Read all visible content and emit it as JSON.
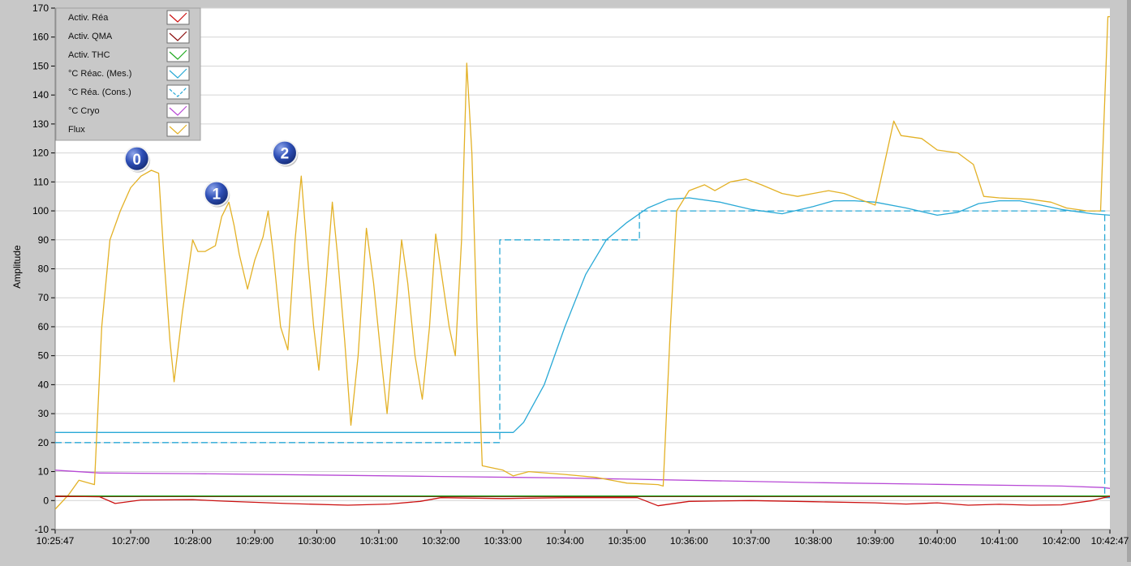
{
  "chart_data": {
    "type": "line",
    "ylabel": "Amplitude",
    "xlabel": "",
    "ylim": [
      -10,
      170
    ],
    "yticks": [
      -10,
      0,
      10,
      20,
      30,
      40,
      50,
      60,
      70,
      80,
      90,
      100,
      110,
      120,
      130,
      140,
      150,
      160,
      170
    ],
    "xlim": [
      "10:25:47",
      "10:42:47"
    ],
    "xticks": [
      "10:25:47",
      "10:27:00",
      "10:28:00",
      "10:29:00",
      "10:30:00",
      "10:31:00",
      "10:32:00",
      "10:33:00",
      "10:34:00",
      "10:35:00",
      "10:36:00",
      "10:37:00",
      "10:38:00",
      "10:39:00",
      "10:40:00",
      "10:41:00",
      "10:42:00",
      "10:42:47"
    ],
    "grid": "horizontal",
    "legend_position": "top-left",
    "annotations": [
      {
        "label": "0",
        "x": "10:27:06",
        "y": 118
      },
      {
        "label": "1",
        "x": "10:28:23",
        "y": 106
      },
      {
        "label": "2",
        "x": "10:29:29",
        "y": 120
      }
    ],
    "series": [
      {
        "name": "Activ. Réa",
        "color": "#cc1111",
        "style": "solid",
        "points": [
          [
            "10:25:47",
            1.5
          ],
          [
            "10:26:30",
            1.3
          ],
          [
            "10:26:45",
            -1
          ],
          [
            "10:27:10",
            0.2
          ],
          [
            "10:28:00",
            0.3
          ],
          [
            "10:28:30",
            -0.2
          ],
          [
            "10:29:30",
            -1
          ],
          [
            "10:30:30",
            -1.6
          ],
          [
            "10:31:10",
            -1.2
          ],
          [
            "10:31:40",
            -0.3
          ],
          [
            "10:32:00",
            1
          ],
          [
            "10:33:00",
            0.7
          ],
          [
            "10:34:00",
            1
          ],
          [
            "10:35:10",
            1
          ],
          [
            "10:35:30",
            -1.8
          ],
          [
            "10:36:00",
            -0.3
          ],
          [
            "10:37:00",
            0
          ],
          [
            "10:38:00",
            -0.4
          ],
          [
            "10:39:00",
            -0.8
          ],
          [
            "10:39:30",
            -1.2
          ],
          [
            "10:40:00",
            -0.8
          ],
          [
            "10:40:30",
            -1.6
          ],
          [
            "10:41:00",
            -1.3
          ],
          [
            "10:41:30",
            -1.6
          ],
          [
            "10:42:00",
            -1.5
          ],
          [
            "10:42:30",
            0
          ],
          [
            "10:42:47",
            1.5
          ]
        ]
      },
      {
        "name": "Activ. QMA",
        "color": "#8b0d0d",
        "style": "solid",
        "points": [
          [
            "10:25:47",
            1.4
          ],
          [
            "10:42:47",
            1.4
          ]
        ]
      },
      {
        "name": "Activ. THC",
        "color": "#22aa22",
        "style": "solid",
        "points": [
          [
            "10:25:47",
            1.6
          ],
          [
            "10:42:47",
            1.6
          ]
        ]
      },
      {
        "name": "°C Réac. (Mes.)",
        "color": "#29a9d6",
        "style": "solid",
        "points": [
          [
            "10:25:47",
            23.5
          ],
          [
            "10:33:00",
            23.5
          ],
          [
            "10:33:10",
            23.5
          ],
          [
            "10:33:20",
            27
          ],
          [
            "10:33:40",
            40
          ],
          [
            "10:34:00",
            60
          ],
          [
            "10:34:20",
            78
          ],
          [
            "10:34:40",
            90
          ],
          [
            "10:35:00",
            96
          ],
          [
            "10:35:20",
            101
          ],
          [
            "10:35:40",
            104
          ],
          [
            "10:36:00",
            104.5
          ],
          [
            "10:36:30",
            103
          ],
          [
            "10:37:00",
            100.5
          ],
          [
            "10:37:30",
            99
          ],
          [
            "10:38:00",
            101.5
          ],
          [
            "10:38:20",
            103.5
          ],
          [
            "10:38:40",
            103.5
          ],
          [
            "10:39:00",
            103
          ],
          [
            "10:39:30",
            101
          ],
          [
            "10:40:00",
            98.5
          ],
          [
            "10:40:20",
            99.5
          ],
          [
            "10:40:40",
            102.5
          ],
          [
            "10:41:00",
            103.5
          ],
          [
            "10:41:20",
            103.5
          ],
          [
            "10:41:40",
            102
          ],
          [
            "10:42:00",
            100.5
          ],
          [
            "10:42:30",
            99
          ],
          [
            "10:42:47",
            98.5
          ]
        ]
      },
      {
        "name": "°C Réa. (Cons.)",
        "color": "#29a9d6",
        "style": "dashed",
        "points": [
          [
            "10:25:47",
            20
          ],
          [
            "10:32:57",
            20
          ],
          [
            "10:32:57",
            90
          ],
          [
            "10:35:12",
            90
          ],
          [
            "10:35:12",
            100
          ],
          [
            "10:42:42",
            100
          ],
          [
            "10:42:42",
            1
          ],
          [
            "10:42:47",
            1
          ]
        ]
      },
      {
        "name": "°C Cryo",
        "color": "#b84ad6",
        "style": "solid",
        "points": [
          [
            "10:25:47",
            10.5
          ],
          [
            "10:26:30",
            9.5
          ],
          [
            "10:28:00",
            9.3
          ],
          [
            "10:30:00",
            8.8
          ],
          [
            "10:32:00",
            8.3
          ],
          [
            "10:34:00",
            7.8
          ],
          [
            "10:36:00",
            7
          ],
          [
            "10:38:00",
            6.2
          ],
          [
            "10:40:00",
            5.6
          ],
          [
            "10:42:00",
            5
          ],
          [
            "10:42:40",
            4.5
          ],
          [
            "10:42:47",
            4.2
          ]
        ]
      },
      {
        "name": "Flux",
        "color": "#e3b126",
        "style": "solid",
        "points": [
          [
            "10:25:47",
            -3
          ],
          [
            "10:26:00",
            2
          ],
          [
            "10:26:10",
            7
          ],
          [
            "10:26:25",
            5.5
          ],
          [
            "10:26:32",
            60
          ],
          [
            "10:26:40",
            90
          ],
          [
            "10:26:50",
            100
          ],
          [
            "10:27:00",
            108
          ],
          [
            "10:27:10",
            112
          ],
          [
            "10:27:20",
            114
          ],
          [
            "10:27:27",
            113
          ],
          [
            "10:27:32",
            85
          ],
          [
            "10:27:38",
            55
          ],
          [
            "10:27:42",
            41
          ],
          [
            "10:27:50",
            65
          ],
          [
            "10:27:56",
            80
          ],
          [
            "10:28:00",
            90
          ],
          [
            "10:28:05",
            86
          ],
          [
            "10:28:12",
            86
          ],
          [
            "10:28:22",
            88
          ],
          [
            "10:28:28",
            98
          ],
          [
            "10:28:35",
            103
          ],
          [
            "10:28:40",
            95
          ],
          [
            "10:28:45",
            85
          ],
          [
            "10:28:53",
            73
          ],
          [
            "10:29:00",
            83
          ],
          [
            "10:29:08",
            91
          ],
          [
            "10:29:13",
            100
          ],
          [
            "10:29:18",
            85
          ],
          [
            "10:29:25",
            60
          ],
          [
            "10:29:32",
            52
          ],
          [
            "10:29:39",
            90
          ],
          [
            "10:29:45",
            112
          ],
          [
            "10:29:52",
            80
          ],
          [
            "10:29:57",
            60
          ],
          [
            "10:30:02",
            45
          ],
          [
            "10:30:09",
            75
          ],
          [
            "10:30:15",
            103
          ],
          [
            "10:30:20",
            85
          ],
          [
            "10:30:27",
            55
          ],
          [
            "10:30:33",
            26
          ],
          [
            "10:30:40",
            50
          ],
          [
            "10:30:48",
            94
          ],
          [
            "10:30:55",
            75
          ],
          [
            "10:31:02",
            50
          ],
          [
            "10:31:08",
            30
          ],
          [
            "10:31:14",
            55
          ],
          [
            "10:31:22",
            90
          ],
          [
            "10:31:28",
            75
          ],
          [
            "10:31:35",
            50
          ],
          [
            "10:31:42",
            35
          ],
          [
            "10:31:49",
            60
          ],
          [
            "10:31:55",
            92
          ],
          [
            "10:32:02",
            75
          ],
          [
            "10:32:08",
            60
          ],
          [
            "10:32:14",
            50
          ],
          [
            "10:32:20",
            90
          ],
          [
            "10:32:25",
            151
          ],
          [
            "10:32:30",
            120
          ],
          [
            "10:32:35",
            60
          ],
          [
            "10:32:40",
            12
          ],
          [
            "10:33:00",
            10.5
          ],
          [
            "10:33:10",
            8.5
          ],
          [
            "10:33:25",
            10
          ],
          [
            "10:34:00",
            9
          ],
          [
            "10:34:30",
            8
          ],
          [
            "10:35:00",
            6
          ],
          [
            "10:35:30",
            5.5
          ],
          [
            "10:35:35",
            5
          ],
          [
            "10:35:42",
            60
          ],
          [
            "10:35:48",
            100
          ],
          [
            "10:36:00",
            107
          ],
          [
            "10:36:15",
            109
          ],
          [
            "10:36:25",
            107
          ],
          [
            "10:36:40",
            110
          ],
          [
            "10:36:55",
            111
          ],
          [
            "10:37:10",
            109
          ],
          [
            "10:37:30",
            106
          ],
          [
            "10:37:45",
            105
          ],
          [
            "10:38:00",
            106
          ],
          [
            "10:38:15",
            107
          ],
          [
            "10:38:30",
            106
          ],
          [
            "10:38:45",
            104
          ],
          [
            "10:39:00",
            102
          ],
          [
            "10:39:10",
            118
          ],
          [
            "10:39:18",
            131
          ],
          [
            "10:39:25",
            126
          ],
          [
            "10:39:45",
            125
          ],
          [
            "10:40:00",
            121
          ],
          [
            "10:40:20",
            120
          ],
          [
            "10:40:35",
            116
          ],
          [
            "10:40:45",
            105
          ],
          [
            "10:41:00",
            104.5
          ],
          [
            "10:41:30",
            104
          ],
          [
            "10:41:50",
            103
          ],
          [
            "10:42:05",
            101
          ],
          [
            "10:42:25",
            100
          ],
          [
            "10:42:38",
            100
          ],
          [
            "10:42:45",
            167
          ],
          [
            "10:43:10",
            168
          ],
          [
            "10:43:30",
            168
          ],
          [
            "10:43:38",
            108
          ]
        ]
      }
    ]
  }
}
